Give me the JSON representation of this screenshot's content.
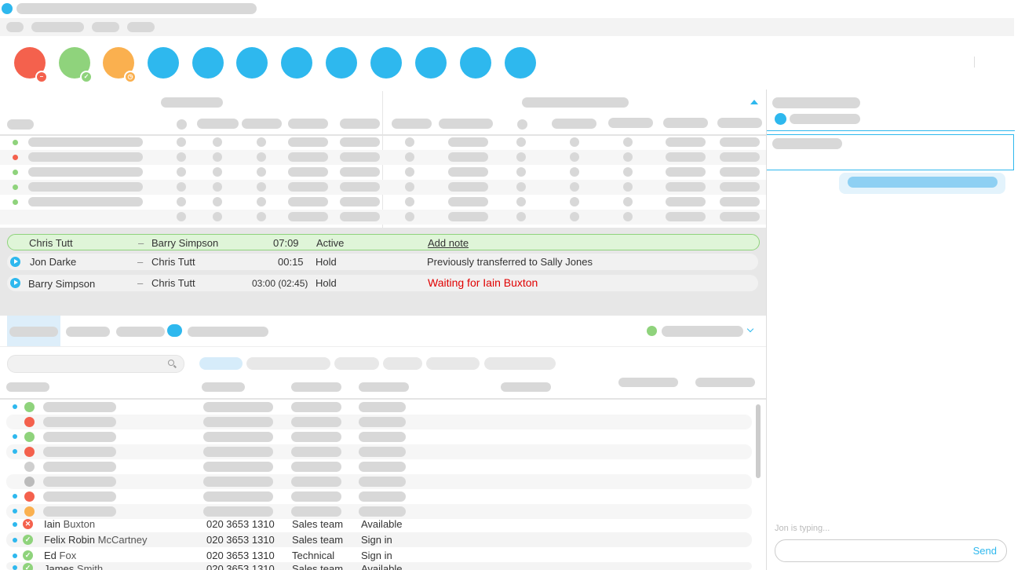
{
  "calls": [
    {
      "caller": "Chris Tutt",
      "dash": "–",
      "agent": "Barry Simpson",
      "time": "07:09",
      "status": "Active",
      "info": "Add note"
    },
    {
      "caller": "Jon Darke",
      "dash": "–",
      "agent": "Chris Tutt",
      "time": "00:15",
      "status": "Hold",
      "info": "Previously transferred to Sally Jones"
    },
    {
      "caller": "Barry Simpson",
      "dash": "–",
      "agent": "Chris Tutt",
      "time": "03:00 (02:45)",
      "status": "Hold",
      "info": "Waiting for Iain Buxton"
    }
  ],
  "contacts": [
    {
      "first": "Iain",
      "last": " Buxton",
      "phone": "020 3653 1310",
      "team": "Sales team",
      "availability": "Available",
      "status": "busy"
    },
    {
      "first": "Felix Robin",
      "last": " McCartney",
      "phone": "020 3653 1310",
      "team": "Sales team",
      "availability": "Sign in",
      "status": "ok"
    },
    {
      "first": "Ed",
      "last": " Fox",
      "phone": "020 3653 1310",
      "team": "Technical",
      "availability": "Sign in",
      "status": "ok"
    },
    {
      "first": "James",
      "last": " Smith",
      "phone": "020 3653 1310",
      "team": "Sales team",
      "availability": "Available",
      "status": "ok"
    }
  ],
  "chat": {
    "typing": "Jon is typing...",
    "send": "Send",
    "input_value": ""
  },
  "icons": {
    "dnd": "minus-icon",
    "available": "check-icon",
    "away": "clock-icon",
    "search": "search-icon",
    "chevron": "chevron-down-icon",
    "sort": "sort-up-icon",
    "play": "play-icon"
  },
  "colors": {
    "accent": "#2eb8ee",
    "busy": "#f4614d",
    "ok": "#8fd37c",
    "away": "#fab04f",
    "warning": "#e00000"
  }
}
